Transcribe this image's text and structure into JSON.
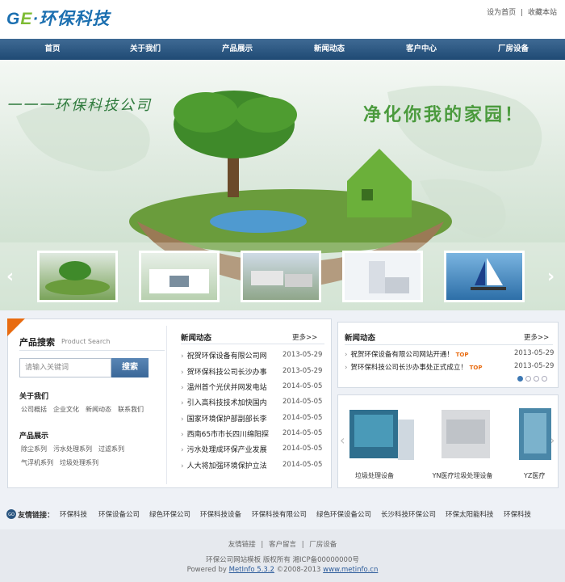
{
  "header": {
    "logo_a": "G",
    "logo_b": "E",
    "logo_c": "·环保科技",
    "set_home": "设为首页",
    "sep": "|",
    "bookmark": "收藏本站"
  },
  "nav": [
    "首页",
    "关于我们",
    "产品展示",
    "新闻动态",
    "客户中心",
    "厂房设备"
  ],
  "banner": {
    "slogan_left": "一一一环保科技公司",
    "slogan_right": "净化你我的家园！"
  },
  "search": {
    "title": "产品搜索",
    "subtitle": "Product Search",
    "placeholder": "请输入关键词",
    "button": "搜索"
  },
  "about": {
    "title": "关于我们",
    "links": [
      "公司概括",
      "企业文化",
      "新闻动态",
      "联系我们"
    ]
  },
  "products": {
    "title": "产品展示",
    "links": [
      "除尘系列",
      "污水处理系列",
      "过滤系列",
      "气浮机系列",
      "垃圾处理系列"
    ]
  },
  "news_mid": {
    "title": "新闻动态",
    "more": "更多>>",
    "items": [
      {
        "title": "祝贺环保设备有限公司网",
        "date": "2013-05-29"
      },
      {
        "title": "贺环保科技公司长沙办事",
        "date": "2013-05-29"
      },
      {
        "title": "温州首个光伏并网发电站",
        "date": "2014-05-05"
      },
      {
        "title": "引入高科技技术加快国内",
        "date": "2014-05-05"
      },
      {
        "title": "国家环境保护部副部长李",
        "date": "2014-05-05"
      },
      {
        "title": "西南65市市长四川绵阳探",
        "date": "2014-05-05"
      },
      {
        "title": "污水处理成环保产业发展",
        "date": "2014-05-05"
      },
      {
        "title": "人大将加强环境保护立法",
        "date": "2014-05-05"
      }
    ]
  },
  "news_right": {
    "title": "新闻动态",
    "more": "更多>>",
    "top_tag": "TOP",
    "items": [
      {
        "title": "祝贺环保设备有限公司网站开通！",
        "date": "2013-05-29"
      },
      {
        "title": "贺环保科技公司长沙办事处正式成立！",
        "date": "2013-05-29"
      }
    ]
  },
  "product_scroll": {
    "labels": [
      "垃圾处理设备",
      "YN医疗垃圾处理设备",
      "YZ医疗"
    ]
  },
  "friends": {
    "label": "友情链接：",
    "links": [
      "环保科技",
      "环保设备公司",
      "绿色环保公司",
      "环保科技设备",
      "环保科技有限公司",
      "绿色环保设备公司",
      "长沙科技环保公司",
      "环保太阳能科技",
      "环保科技"
    ]
  },
  "footer": {
    "links": [
      "友情链接",
      "客户留言",
      "厂房设备"
    ],
    "sep": "|",
    "copyright": "环保公司网站模板 版权所有 湘ICP备00000000号",
    "powered_pre": "Powered by ",
    "metinfo": "MetInfo 5.3.2",
    "powered_mid": " ©2008-2013 ",
    "site": "www.metinfo.cn"
  },
  "colors": {
    "nav": "#2a5580",
    "accent": "#e86b10",
    "green": "#4a9a3c"
  }
}
